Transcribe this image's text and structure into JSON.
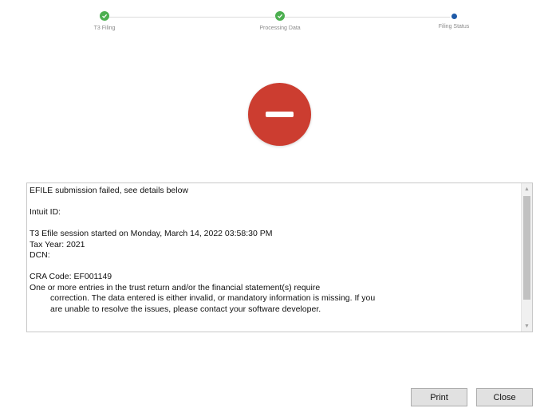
{
  "stepper": {
    "steps": [
      {
        "label": "T3 Filing",
        "state": "done"
      },
      {
        "label": "Processing Data",
        "state": "done"
      },
      {
        "label": "Filing Status",
        "state": "current"
      }
    ],
    "colors": {
      "done": "#4caf50",
      "current": "#1e5aa8"
    }
  },
  "status": {
    "icon": "error-minus-circle-icon",
    "color": "#cc3d30"
  },
  "log": {
    "line1": "EFILE submission failed, see details below",
    "line2": "Intuit ID:",
    "line3": "T3 Efile session started on Monday, March 14, 2022 03:58:30 PM",
    "line4": "Tax Year: 2021",
    "line5": "DCN:",
    "line6": "CRA Code: EF001149",
    "line7": "One or more entries in the trust return and/or the financial statement(s) require",
    "line8": "correction. The data entered is either invalid, or mandatory information is missing. If you",
    "line9": "are unable to resolve the issues, please contact your software developer."
  },
  "buttons": {
    "print": "Print",
    "close": "Close"
  }
}
